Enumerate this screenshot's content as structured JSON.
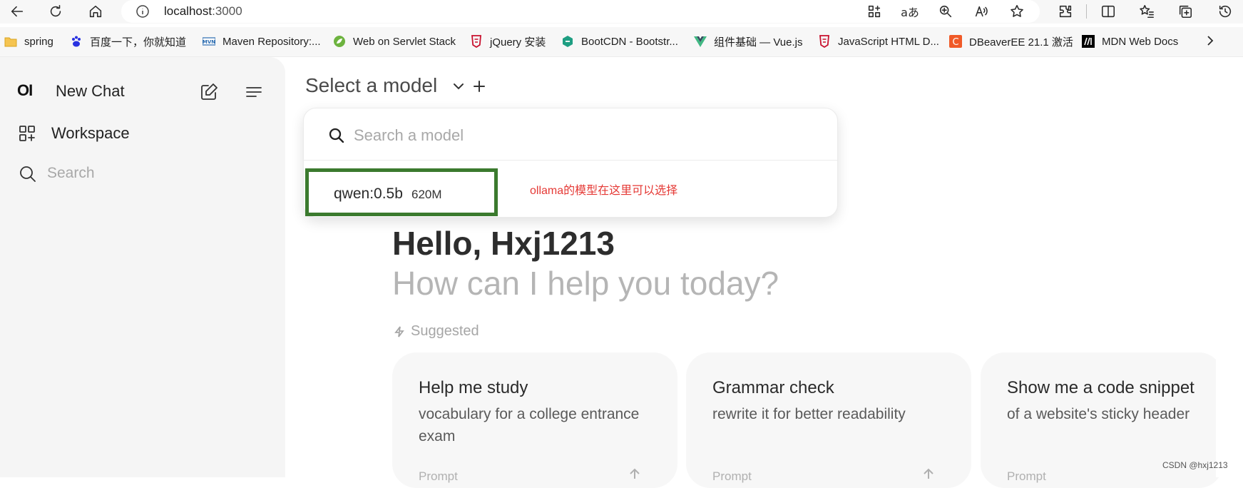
{
  "browser": {
    "url_host": "localhost",
    "url_port": ":3000",
    "icons": [
      "back-icon",
      "refresh-icon",
      "home-icon",
      "info-icon",
      "app-grid-icon",
      "translate-icon",
      "zoom-icon",
      "read-aloud-icon",
      "favorite-star-icon",
      "extensions-icon",
      "split-screen-icon",
      "favorites-list-icon",
      "collections-icon",
      "history-icon"
    ],
    "translate_glyph": "aあ",
    "read_aloud_glyph": "A)"
  },
  "bookmarks": [
    {
      "label": "spring",
      "icon": "folder-icon"
    },
    {
      "label": "百度一下，你就知道",
      "icon": "baidu-icon"
    },
    {
      "label": "Maven Repository:...",
      "icon": "maven-icon"
    },
    {
      "label": "Web on Servlet Stack",
      "icon": "spring-leaf-icon"
    },
    {
      "label": "jQuery 安装",
      "icon": "html-shield-icon"
    },
    {
      "label": "BootCDN - Bootstr...",
      "icon": "bootcdn-icon"
    },
    {
      "label": "组件基础 — Vue.js",
      "icon": "vue-icon"
    },
    {
      "label": "JavaScript HTML D...",
      "icon": "html-shield-icon"
    },
    {
      "label": "DBeaverEE 21.1 激活",
      "icon": "dbeaver-c-icon"
    },
    {
      "label": "MDN Web Docs",
      "icon": "mdn-icon"
    }
  ],
  "sidebar": {
    "logo": "OI",
    "new_chat": "New Chat",
    "workspace": "Workspace",
    "search_placeholder": "Search"
  },
  "header": {
    "model_select_label": "Select a model"
  },
  "model_dropdown": {
    "search_placeholder": "Search a model",
    "items": [
      {
        "name": "qwen:0.5b",
        "size": "620M"
      }
    ],
    "annotation": "ollama的模型在这里可以选择"
  },
  "main": {
    "greeting": "Hello, Hxj1213",
    "subgreeting": "How can I help you today?",
    "suggested_label": "Suggested",
    "cards": [
      {
        "title": "Help me study",
        "subtitle": "vocabulary for a college entrance exam",
        "footer": "Prompt"
      },
      {
        "title": "Grammar check",
        "subtitle": "rewrite it for better readability",
        "footer": "Prompt"
      },
      {
        "title": "Show me a code snippet",
        "subtitle": "of a website's sticky header",
        "footer": "Prompt"
      }
    ]
  },
  "watermark": "CSDN @hxj1213",
  "colors": {
    "highlight_border": "#3b7a2e",
    "annotation_text": "#e53935",
    "sidebar_bg": "#f5f5f5"
  }
}
